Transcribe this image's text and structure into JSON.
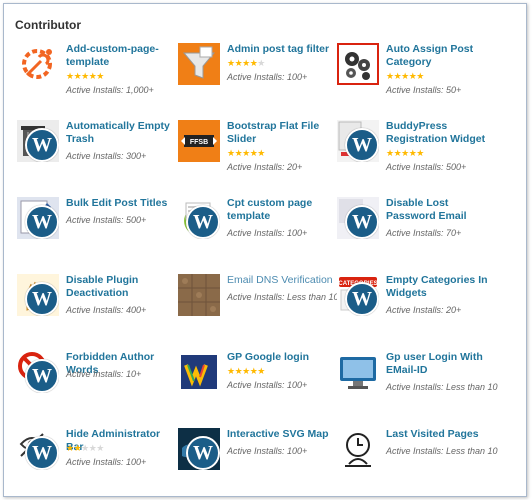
{
  "section": {
    "title": "Contributor"
  },
  "plugins": [
    {
      "name": "Add-custom-page-template",
      "rating": 4.5,
      "installs": "Active Installs: 1,000+",
      "icon": "gear-wrench-icon"
    },
    {
      "name": "Admin post tag filter",
      "rating": 3.5,
      "installs": "Active Installs: 100+",
      "icon": "funnel-icon"
    },
    {
      "name": "Auto Assign Post Category",
      "rating": 5,
      "installs": "Active Installs: 50+",
      "icon": "gears-icon"
    },
    {
      "name": "Automatically Empty Trash",
      "rating": 0,
      "installs": "Active Installs: 300+",
      "icon": "trash-wordpress-icon"
    },
    {
      "name": "Bootstrap Flat File Slider",
      "rating": 5,
      "installs": "Active Installs: 20+",
      "icon": "ffsb-icon"
    },
    {
      "name": "BuddyPress Registration Widget",
      "rating": 4.5,
      "installs": "Active Installs: 500+",
      "icon": "buddypress-icon"
    },
    {
      "name": "Bulk Edit Post Titles",
      "rating": 0,
      "installs": "Active Installs: 500+",
      "icon": "pencil-wordpress-icon"
    },
    {
      "name": "Cpt custom page template",
      "rating": 0,
      "installs": "Active Installs: 100+",
      "icon": "recycle-wordpress-icon"
    },
    {
      "name": "Disable Lost Password Email",
      "rating": 0,
      "installs": "Active Installs: 70+",
      "icon": "wordpress-icon"
    },
    {
      "name": "Disable Plugin Deactivation",
      "rating": 0,
      "installs": "Active Installs: 400+",
      "icon": "hand-wordpress-icon"
    },
    {
      "name": "Email DNS Verification",
      "rating": 0,
      "installs": "Active Installs: Less than 10",
      "icon": "brown-pattern-icon",
      "muted": true
    },
    {
      "name": "Empty Categories In Widgets",
      "rating": 0,
      "installs": "Active Installs: 20+",
      "icon": "categories-icon"
    },
    {
      "name": "Forbidden Author Words",
      "rating": 0,
      "installs": "Active Installs: 10+",
      "icon": "forbidden-wordpress-icon"
    },
    {
      "name": "GP Google login",
      "rating": 5,
      "installs": "Active Installs: 100+",
      "icon": "google-w-icon"
    },
    {
      "name": "Gp user Login With EMail-ID",
      "rating": 0,
      "installs": "Active Installs: Less than 10",
      "icon": "monitor-icon"
    },
    {
      "name": "Hide Administrator Bar",
      "rating": 1.5,
      "installs": "Active Installs: 100+",
      "icon": "eye-wordpress-icon"
    },
    {
      "name": "Interactive SVG Map",
      "rating": 0,
      "installs": "Active Installs: 100+",
      "icon": "map-wordpress-icon"
    },
    {
      "name": "Last Visited Pages",
      "rating": 0,
      "installs": "Active Installs: Less than 10",
      "icon": "clock-person-icon"
    }
  ]
}
